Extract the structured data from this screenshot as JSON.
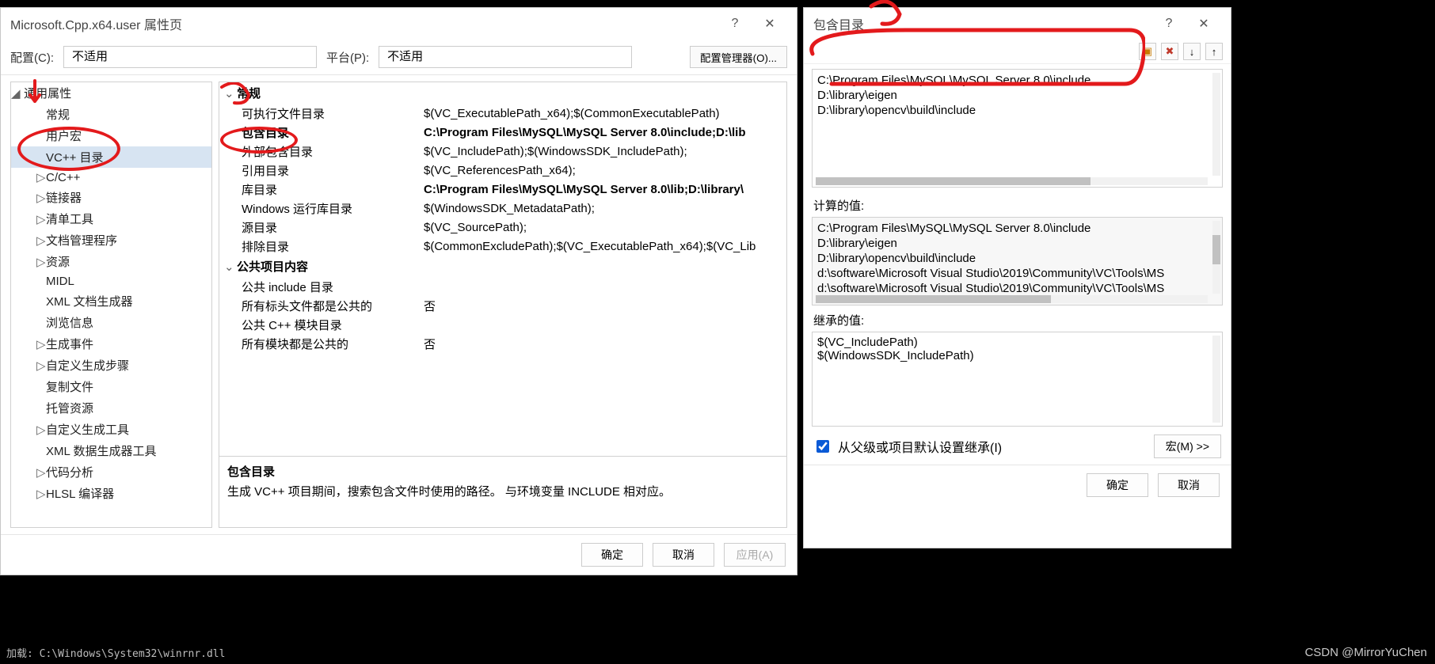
{
  "prop_window": {
    "title": "Microsoft.Cpp.x64.user 属性页",
    "help": "?",
    "close": "✕",
    "config_label": "配置(C):",
    "config_value": "不适用",
    "platform_label": "平台(P):",
    "platform_value": "不适用",
    "config_mgr": "配置管理器(O)...",
    "tree": {
      "root": "通用属性",
      "items": [
        {
          "label": "常规"
        },
        {
          "label": "用户宏"
        },
        {
          "label": "VC++ 目录",
          "selected": true
        },
        {
          "label": "C/C++",
          "expandable": true
        },
        {
          "label": "链接器",
          "expandable": true
        },
        {
          "label": "清单工具",
          "expandable": true
        },
        {
          "label": "文档管理程序",
          "expandable": true
        },
        {
          "label": "资源",
          "expandable": true
        },
        {
          "label": "MIDL"
        },
        {
          "label": "XML 文档生成器"
        },
        {
          "label": "浏览信息"
        },
        {
          "label": "生成事件",
          "expandable": true
        },
        {
          "label": "自定义生成步骤",
          "expandable": true
        },
        {
          "label": "复制文件"
        },
        {
          "label": "托管资源"
        },
        {
          "label": "自定义生成工具",
          "expandable": true
        },
        {
          "label": "XML 数据生成器工具"
        },
        {
          "label": "代码分析",
          "expandable": true
        },
        {
          "label": "HLSL 编译器",
          "expandable": true
        }
      ]
    },
    "grid": {
      "cat_general": "常规",
      "rows_general": [
        {
          "k": "可执行文件目录",
          "v": "$(VC_ExecutablePath_x64);$(CommonExecutablePath)"
        },
        {
          "k": "包含目录",
          "v": "C:\\Program Files\\MySQL\\MySQL Server 8.0\\include;D:\\lib",
          "sel": true
        },
        {
          "k": "外部包含目录",
          "v": "$(VC_IncludePath);$(WindowsSDK_IncludePath);"
        },
        {
          "k": "引用目录",
          "v": "$(VC_ReferencesPath_x64);"
        },
        {
          "k": "库目录",
          "v": "C:\\Program Files\\MySQL\\MySQL Server 8.0\\lib;D:\\library\\",
          "bold": true
        },
        {
          "k": "Windows 运行库目录",
          "v": "$(WindowsSDK_MetadataPath);"
        },
        {
          "k": "源目录",
          "v": "$(VC_SourcePath);"
        },
        {
          "k": "排除目录",
          "v": "$(CommonExcludePath);$(VC_ExecutablePath_x64);$(VC_Lib"
        }
      ],
      "cat_public": "公共项目内容",
      "rows_public": [
        {
          "k": "公共 include 目录",
          "v": ""
        },
        {
          "k": "所有标头文件都是公共的",
          "v": "否"
        },
        {
          "k": "公共 C++ 模块目录",
          "v": ""
        },
        {
          "k": "所有模块都是公共的",
          "v": "否"
        }
      ]
    },
    "desc": {
      "title": "包含目录",
      "text": "生成 VC++ 项目期间，搜索包含文件时使用的路径。 与环境变量 INCLUDE 相对应。"
    },
    "buttons": {
      "ok": "确定",
      "cancel": "取消",
      "apply": "应用(A)"
    }
  },
  "dialog": {
    "title": "包含目录",
    "help": "?",
    "close": "✕",
    "tools": {
      "new": "folder",
      "delete": "✖",
      "down": "↓",
      "up": "↑"
    },
    "list": [
      "C:\\Program Files\\MySQL\\MySQL Server 8.0\\include",
      "D:\\library\\eigen",
      "D:\\library\\opencv\\build\\include"
    ],
    "computed_label": "计算的值:",
    "computed": [
      "C:\\Program Files\\MySQL\\MySQL Server 8.0\\include",
      "D:\\library\\eigen",
      "D:\\library\\opencv\\build\\include",
      "d:\\software\\Microsoft Visual Studio\\2019\\Community\\VC\\Tools\\MS",
      "d:\\software\\Microsoft Visual Studio\\2019\\Community\\VC\\Tools\\MS"
    ],
    "inherited_label": "继承的值:",
    "inherited": [
      "$(VC_IncludePath)",
      "$(WindowsSDK_IncludePath)"
    ],
    "inherit_chk": "从父级或项目默认设置继承(I)",
    "macros_btn": "宏(M) >>",
    "ok": "确定",
    "cancel": "取消"
  },
  "console": "加载:  C:\\Windows\\System32\\winrnr.dll",
  "watermark": "CSDN @MirrorYuChen"
}
